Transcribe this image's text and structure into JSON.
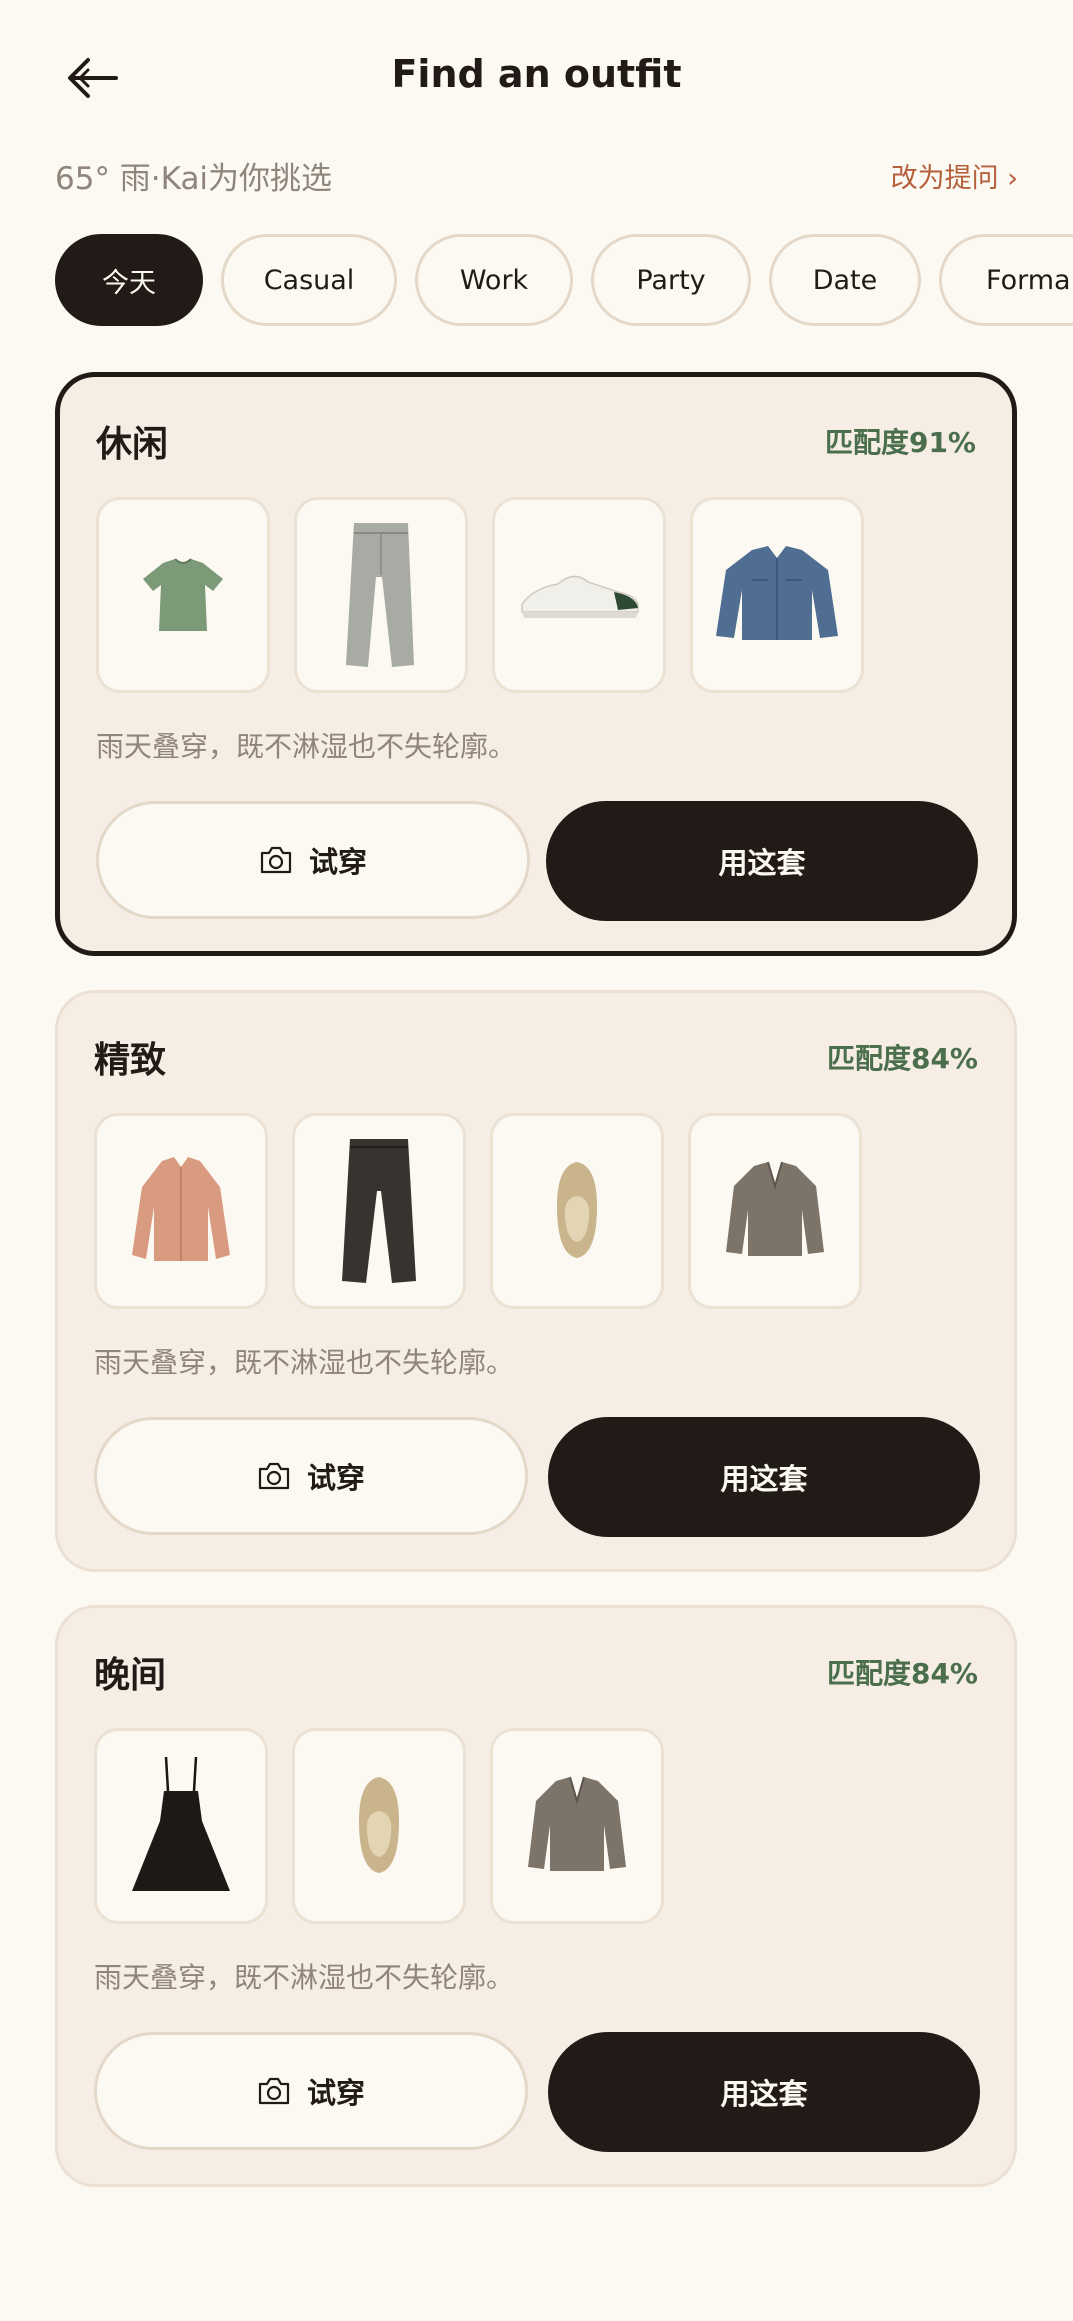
{
  "header": {
    "title": "Find an outfit",
    "back_icon": "arrow-left-icon"
  },
  "context": {
    "weather_text": "65° 雨·Kai为你挑选",
    "switch_link": "改为提问 ›"
  },
  "chips": [
    {
      "label": "今天",
      "active": true
    },
    {
      "label": "Casual",
      "active": false
    },
    {
      "label": "Work",
      "active": false
    },
    {
      "label": "Party",
      "active": false
    },
    {
      "label": "Date",
      "active": false
    },
    {
      "label": "Forma",
      "active": false
    }
  ],
  "outfits": [
    {
      "title": "休闲",
      "match": "匹配度91%",
      "selected": true,
      "items": [
        "green-tshirt",
        "grey-jeans",
        "white-sneaker",
        "denim-jacket"
      ],
      "note": "雨天叠穿，既不淋湿也不失轮廓。",
      "try_label": "试穿",
      "use_label": "用这套"
    },
    {
      "title": "精致",
      "match": "匹配度84%",
      "selected": false,
      "items": [
        "peach-blouse",
        "dark-trousers",
        "beige-flat",
        "tweed-blazer"
      ],
      "note": "雨天叠穿，既不淋湿也不失轮廓。",
      "try_label": "试穿",
      "use_label": "用这套"
    },
    {
      "title": "晚间",
      "match": "匹配度84%",
      "selected": false,
      "items": [
        "black-slip-dress",
        "beige-flat",
        "tweed-blazer"
      ],
      "note": "雨天叠穿，既不淋湿也不失轮廓。",
      "try_label": "试穿",
      "use_label": "用这套"
    }
  ],
  "colors": {
    "background": "#fcf9f3",
    "ink": "#221a16",
    "muted": "#8f857b",
    "accent_link": "#b5603c",
    "match_green": "#4b6f4c",
    "card_bg": "#f6ede4"
  }
}
